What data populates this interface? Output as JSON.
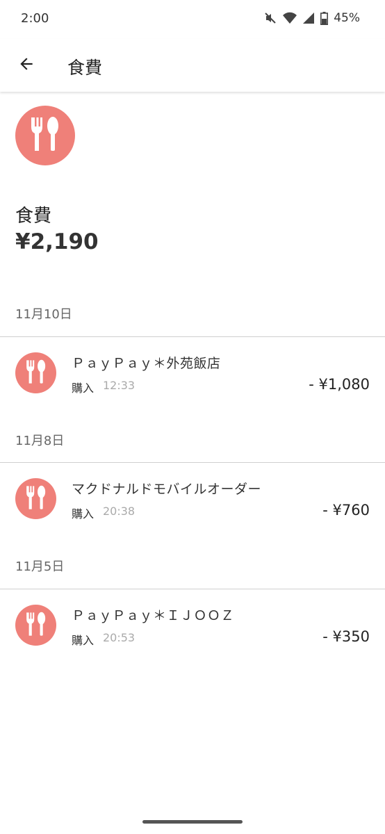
{
  "status_bar": {
    "time": "2:00",
    "battery": "45%",
    "icons": [
      "mute-icon",
      "wifi-icon",
      "signal-icon",
      "battery-icon"
    ]
  },
  "app_bar": {
    "back_icon": "arrow-left-icon",
    "title": "食費"
  },
  "summary": {
    "icon": "fork-spoon-icon",
    "icon_color": "#ef8079",
    "category_name": "食費",
    "total": "¥2,190"
  },
  "groups": [
    {
      "date": "11月10日",
      "transactions": [
        {
          "name": "ＰａｙＰａｙ＊外苑飯店",
          "type": "購入",
          "time": "12:33",
          "amount": "- ¥1,080"
        }
      ]
    },
    {
      "date": "11月8日",
      "transactions": [
        {
          "name": "マクドナルドモバイルオーダー",
          "type": "購入",
          "time": "20:38",
          "amount": "- ¥760"
        }
      ]
    },
    {
      "date": "11月5日",
      "transactions": [
        {
          "name": "ＰａｙＰａｙ＊ＩＪＯＯＺ",
          "type": "購入",
          "time": "20:53",
          "amount": "- ¥350"
        }
      ]
    }
  ]
}
